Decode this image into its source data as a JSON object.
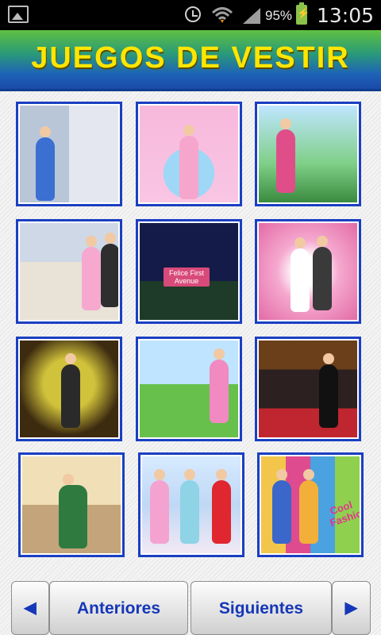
{
  "status_bar": {
    "battery_percent": "95%",
    "time": "13:05",
    "icons": [
      "gallery-icon",
      "alarm-icon",
      "wifi-icon",
      "signal-icon",
      "battery-charging-icon"
    ]
  },
  "header": {
    "title": "JUEGOS DE VESTIR"
  },
  "games": [
    {
      "name": "homer-dress-up"
    },
    {
      "name": "baby-bath"
    },
    {
      "name": "mom-stroller-dress-up"
    },
    {
      "name": "wedding-car"
    },
    {
      "name": "felice-first-avenue",
      "sign_text": "Felice First Avenue"
    },
    {
      "name": "wedding-couple"
    },
    {
      "name": "graffiti-girl"
    },
    {
      "name": "picnic-girl"
    },
    {
      "name": "red-carpet"
    },
    {
      "name": "princess-ballgown"
    },
    {
      "name": "gown-wardrobe"
    },
    {
      "name": "cool-fashion",
      "sign_text": "Cool Fashion"
    }
  ],
  "navigation": {
    "prev_arrow": "◀",
    "prev_label": "Anteriores",
    "next_label": "Siguientes",
    "next_arrow": "▶"
  },
  "colors": {
    "title_yellow": "#ffe600",
    "tile_border": "#1a3fc2",
    "button_text": "#1537b8"
  }
}
